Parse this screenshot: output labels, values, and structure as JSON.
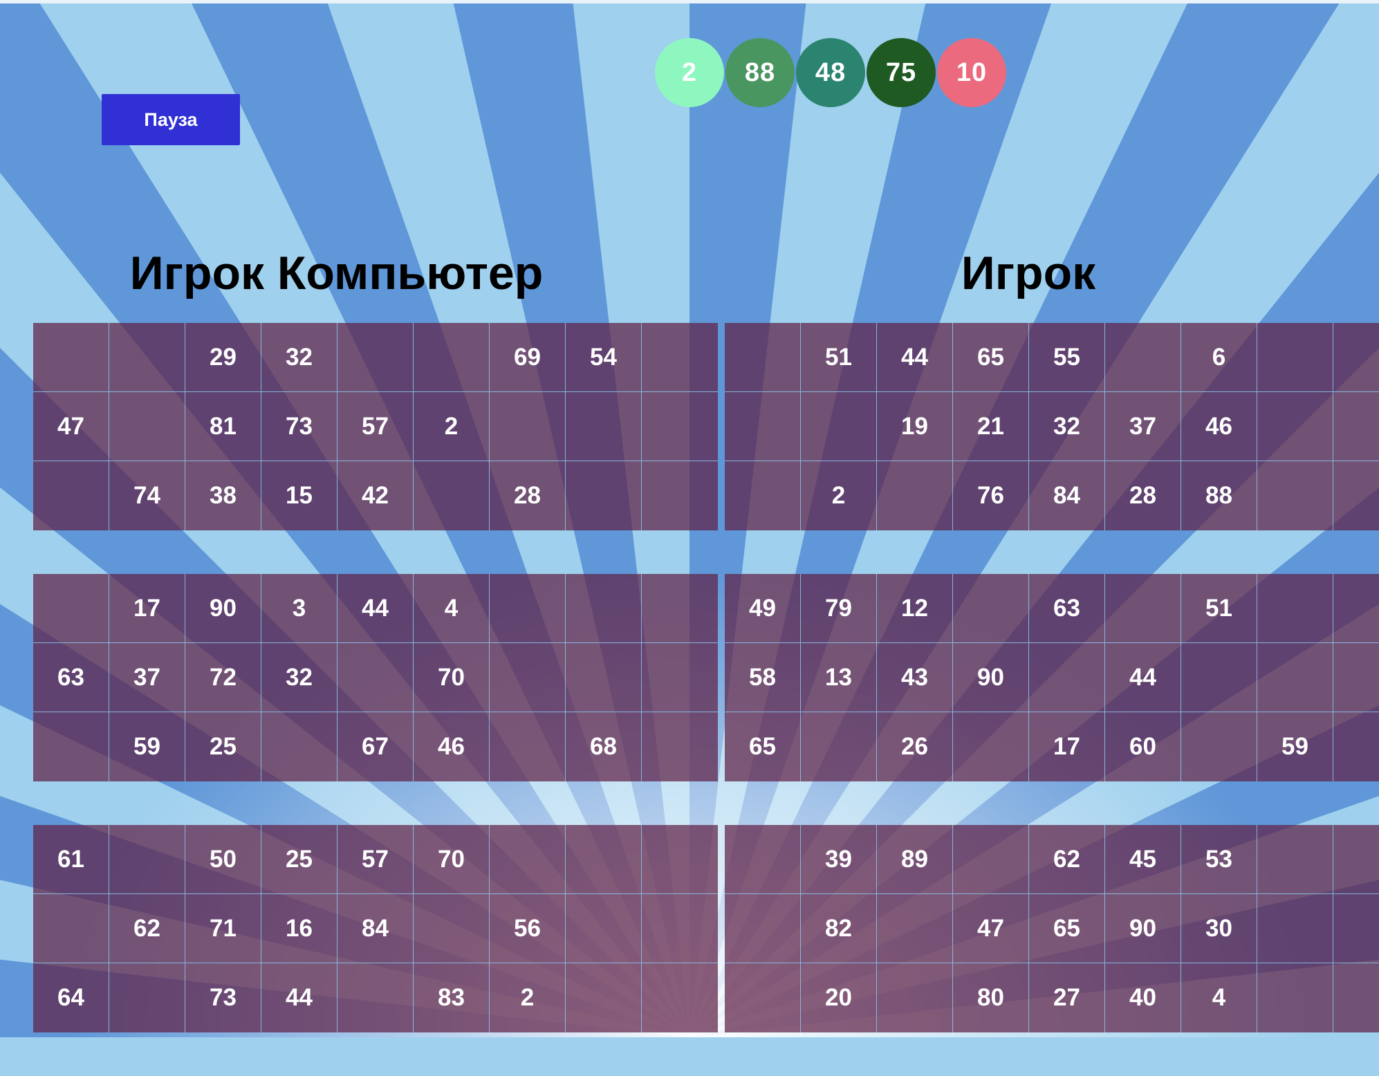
{
  "controls": {
    "pause_label": "Пауза"
  },
  "colors": {
    "background_light": "#9fd0ee",
    "background_ray": "#5f97d8",
    "button": "#3030d4",
    "card_cell": "#5f2146"
  },
  "drawn_balls": [
    {
      "number": "2",
      "color": "#8ef7c0"
    },
    {
      "number": "88",
      "color": "#4a9660"
    },
    {
      "number": "48",
      "color": "#2a8470"
    },
    {
      "number": "75",
      "color": "#1f5a22"
    },
    {
      "number": "10",
      "color": "#ec6a7e"
    }
  ],
  "players": {
    "computer": {
      "title": "Игрок Компьютер",
      "cards": [
        [
          [
            "",
            "",
            "29",
            "32",
            "",
            "",
            "69",
            "54",
            ""
          ],
          [
            "47",
            "",
            "81",
            "73",
            "57",
            "2",
            "",
            "",
            ""
          ],
          [
            "",
            "74",
            "38",
            "15",
            "42",
            "",
            "28",
            "",
            ""
          ]
        ],
        [
          [
            "",
            "17",
            "90",
            "3",
            "44",
            "4",
            "",
            "",
            ""
          ],
          [
            "63",
            "37",
            "72",
            "32",
            "",
            "70",
            "",
            "",
            ""
          ],
          [
            "",
            "59",
            "25",
            "",
            "67",
            "46",
            "",
            "68",
            ""
          ]
        ],
        [
          [
            "61",
            "",
            "50",
            "25",
            "57",
            "70",
            "",
            "",
            ""
          ],
          [
            "",
            "62",
            "71",
            "16",
            "84",
            "",
            "56",
            "",
            ""
          ],
          [
            "64",
            "",
            "73",
            "44",
            "",
            "83",
            "2",
            "",
            ""
          ]
        ]
      ]
    },
    "human": {
      "title": "Игрок",
      "cards": [
        [
          [
            "",
            "51",
            "44",
            "65",
            "55",
            "",
            "6",
            "",
            ""
          ],
          [
            "",
            "",
            "19",
            "21",
            "32",
            "37",
            "46",
            "",
            ""
          ],
          [
            "",
            "2",
            "",
            "76",
            "84",
            "28",
            "88",
            "",
            ""
          ]
        ],
        [
          [
            "49",
            "79",
            "12",
            "",
            "63",
            "",
            "51",
            "",
            ""
          ],
          [
            "58",
            "13",
            "43",
            "90",
            "",
            "44",
            "",
            "",
            ""
          ],
          [
            "65",
            "",
            "26",
            "",
            "17",
            "60",
            "",
            "59",
            ""
          ]
        ],
        [
          [
            "",
            "39",
            "89",
            "",
            "62",
            "45",
            "53",
            "",
            ""
          ],
          [
            "",
            "82",
            "",
            "47",
            "65",
            "90",
            "30",
            "",
            ""
          ],
          [
            "",
            "20",
            "",
            "80",
            "27",
            "40",
            "4",
            "",
            ""
          ]
        ]
      ]
    }
  }
}
